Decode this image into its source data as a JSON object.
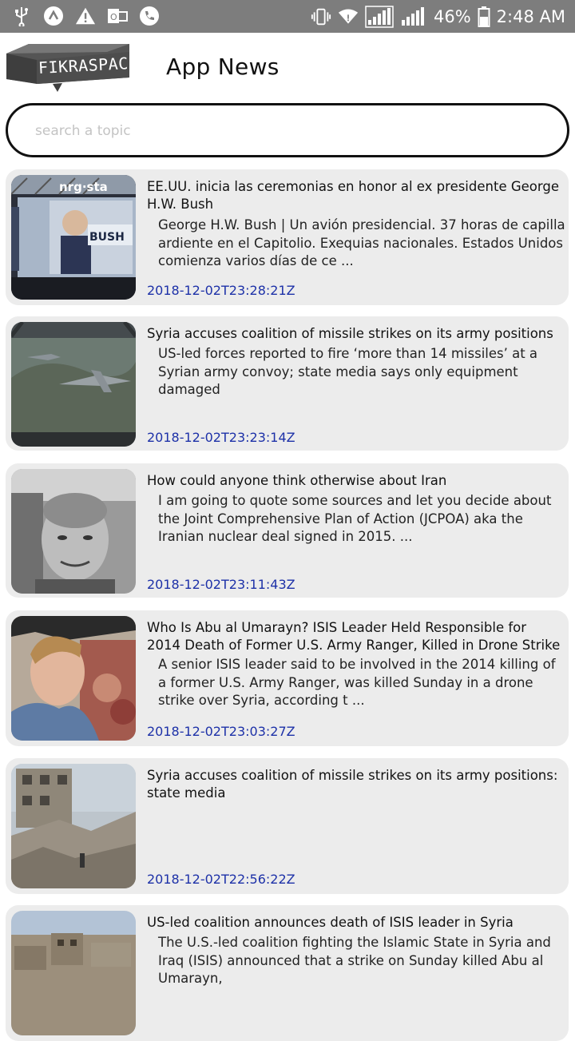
{
  "status_bar": {
    "battery": "46%",
    "time": "2:48 AM",
    "network_a": "3G",
    "network_b": "2G"
  },
  "header": {
    "logo_text": "FIKRASPACE",
    "title": "App News"
  },
  "search": {
    "placeholder": "search a topic",
    "value": ""
  },
  "articles": [
    {
      "title": "EE.UU. inicia las ceremonias en honor al ex presidente George H.W. Bush",
      "description": "George H.W. Bush | Un avión presidencial. 37 horas de capilla ardiente en el Capitolio. Exequias nacionales. Estados Unidos comienza varios días de ce ...",
      "date": "2018-12-02T23:28:21Z",
      "image": "bush-ceremony-photo",
      "image_text": "GEORGE H.W. BUSH",
      "image_brand": "nrg sta"
    },
    {
      "title": "Syria accuses coalition of missile strikes on its army positions",
      "description": "US-led forces reported to fire ‘more than 14 missiles’ at a Syrian army convoy; state media says only equipment damaged",
      "date": "2018-12-02T23:23:14Z",
      "image": "fighter-jets-photo"
    },
    {
      "title": "How could anyone think otherwise about Iran",
      "description": "I am going to quote some sources and let you decide about the Joint Comprehensive Plan of Action (JCPOA) aka the Iranian nuclear deal signed in 2015.  ...",
      "date": "2018-12-02T23:11:43Z",
      "image": "author-portrait-photo"
    },
    {
      "title": "Who Is Abu al Umarayn? ISIS Leader Held Responsible for 2014 Death of Former U.S. Army Ranger, Killed in Drone Strike",
      "description": "A senior ISIS leader said to be involved in the 2014 killing of a former U.S. Army Ranger, was killed Sunday in a drone strike over Syria, according t ...",
      "date": "2018-12-02T23:03:27Z",
      "image": "ranger-portrait-photo"
    },
    {
      "title": "Syria accuses coalition of missile strikes on its army positions: state media",
      "description": "",
      "date": "2018-12-02T22:56:22Z",
      "image": "ruins-photo"
    },
    {
      "title": "US-led coalition announces death of ISIS leader in Syria",
      "description": "The U.S.-led coalition fighting the Islamic State in Syria and Iraq (ISIS) announced that a strike on Sunday killed Abu al Umarayn,",
      "date": "",
      "image": "ruins-city-photo"
    }
  ],
  "colors": {
    "status_bar": "#7d7d7d",
    "card_bg": "#ececec",
    "date_text": "#1d31a8"
  }
}
